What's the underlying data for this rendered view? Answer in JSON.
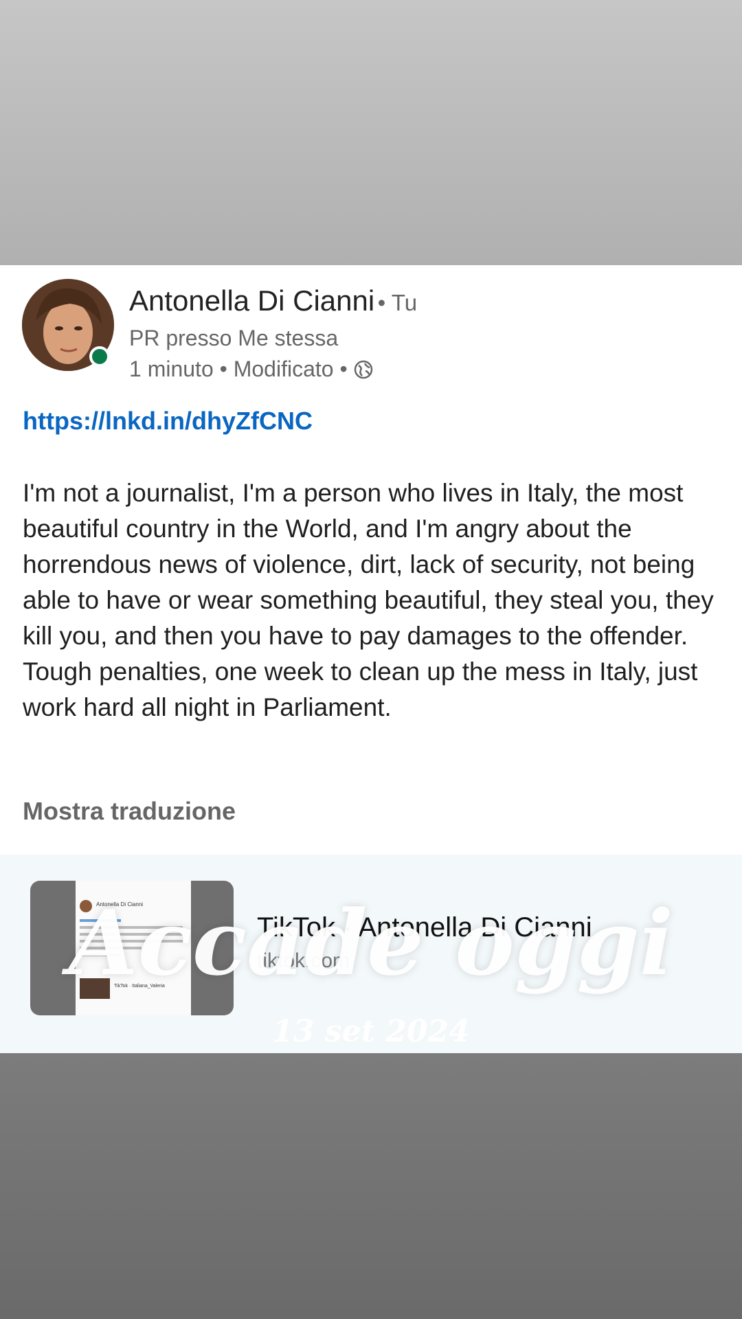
{
  "post": {
    "author": "Antonella Di Cianni",
    "you_label": "• Tu",
    "headline": "PR presso Me stessa",
    "time": "1 minuto",
    "edited": "Modificato",
    "separator": "•",
    "visibility_icon": "globe-icon",
    "link": "https://lnkd.in/dhyZfCNC",
    "paragraphs": [
      "I'm not a journalist, I'm a person who lives in Italy, the most beautiful country in the World, and I'm angry about the horrendous news of violence, dirt, lack of security, not being able to have or wear something  beautiful, they steal you, they kill you, and then you have to pay damages to the offender.",
      "Tough penalties, one week to clean up the mess in Italy, just work hard all night in Parliament."
    ],
    "show_translation": "Mostra traduzione"
  },
  "link_preview": {
    "title": "TikTok · Antonella Di Cianni",
    "domain": "tiktok.com",
    "thumb_name": "Antonella Di Cianni",
    "thumb_tiktok": "TikTok · Italiana_Valeria"
  },
  "overlay": {
    "title": "Accade oggi",
    "date": "13 set 2024"
  },
  "colors": {
    "link": "#0a66c2",
    "presence": "#0b7a4b"
  }
}
